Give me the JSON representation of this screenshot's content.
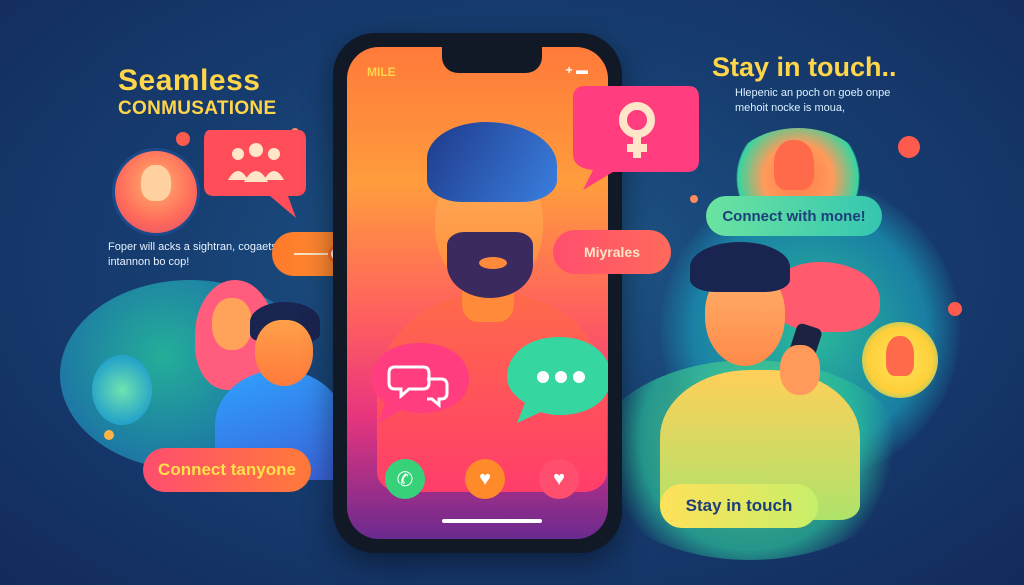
{
  "left": {
    "title_line1": "Seamless",
    "title_line2": "CONMUSATIONE",
    "body": "Foper will acks a sightran, cogaetsg intannon bo cop!",
    "connect_button": "Connect tanyone"
  },
  "phone": {
    "status_left": "MILE",
    "status_right": "+ ▬",
    "name_tag": "Miyrales"
  },
  "right": {
    "title": "Stay in touch..",
    "body": "Hlepenic an poch on goeb onpe mehoit nocke is moua,",
    "connect_bubble": "Connect with mone!",
    "stay_button": "Stay in touch"
  },
  "colors": {
    "yellow": "#ffd54a",
    "coral": "#ff5a4e",
    "pink": "#ff3d7f",
    "green": "#37d17a",
    "orange": "#ff8a2a"
  }
}
